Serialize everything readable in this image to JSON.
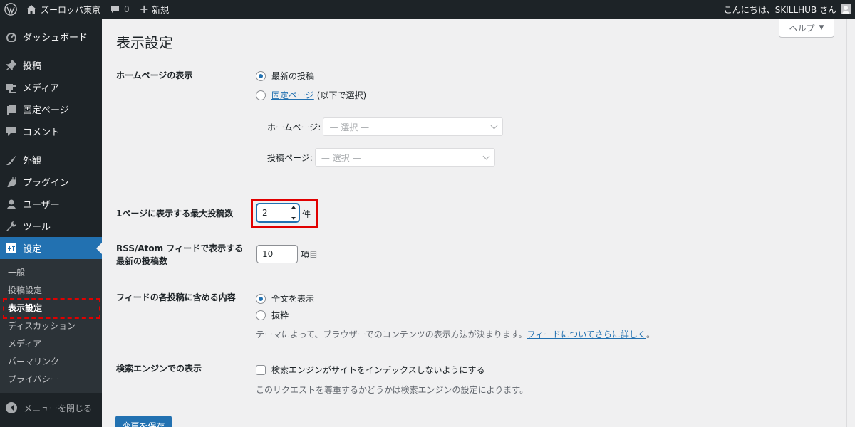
{
  "adminbar": {
    "site_name": "ズーロッパ東京",
    "comments_count": "0",
    "new_label": "新規",
    "greeting": "こんにちは、SKILLHUB さん"
  },
  "sidebar": {
    "items": [
      {
        "label": "ダッシュボード",
        "icon": "dashboard-icon"
      },
      {
        "label": "投稿",
        "icon": "pin-icon"
      },
      {
        "label": "メディア",
        "icon": "media-icon"
      },
      {
        "label": "固定ページ",
        "icon": "page-icon"
      },
      {
        "label": "コメント",
        "icon": "comment-icon"
      },
      {
        "label": "外観",
        "icon": "brush-icon"
      },
      {
        "label": "プラグイン",
        "icon": "plugin-icon"
      },
      {
        "label": "ユーザー",
        "icon": "user-icon"
      },
      {
        "label": "ツール",
        "icon": "wrench-icon"
      },
      {
        "label": "設定",
        "icon": "settings-icon"
      }
    ],
    "submenu": [
      "一般",
      "投稿設定",
      "表示設定",
      "ディスカッション",
      "メディア",
      "パーマリンク",
      "プライバシー"
    ],
    "collapse_label": "メニューを閉じる"
  },
  "main": {
    "title": "表示設定",
    "help_label": "ヘルプ",
    "homepage": {
      "label": "ホームページの表示",
      "option_latest": "最新の投稿",
      "option_static_link": "固定ページ",
      "option_static_suffix": "(以下で選択)",
      "home_page_label": "ホームページ:",
      "posts_page_label": "投稿ページ:",
      "select_placeholder": "— 選択 —"
    },
    "posts_per_page": {
      "label": "1ページに表示する最大投稿数",
      "value": "2",
      "unit": "件"
    },
    "rss": {
      "label_line1": "RSS/Atom フィードで表示する",
      "label_line2": "最新の投稿数",
      "value": "10",
      "unit": "項目"
    },
    "feed_content": {
      "label": "フィードの各投稿に含める内容",
      "option_full": "全文を表示",
      "option_excerpt": "抜粋",
      "desc_text": "テーマによって、ブラウザーでのコンテンツの表示方法が決まります。",
      "desc_link": "フィードについてさらに詳しく",
      "desc_end": "。"
    },
    "search_engine": {
      "label": "検索エンジンでの表示",
      "checkbox_label": "検索エンジンがサイトをインデックスしないようにする",
      "desc": "このリクエストを尊重するかどうかは検索エンジンの設定によります。"
    },
    "save_label": "変更を保存"
  },
  "colors": {
    "accent": "#2271b1",
    "admin_dark": "#1d2327",
    "highlight": "#e10000"
  }
}
